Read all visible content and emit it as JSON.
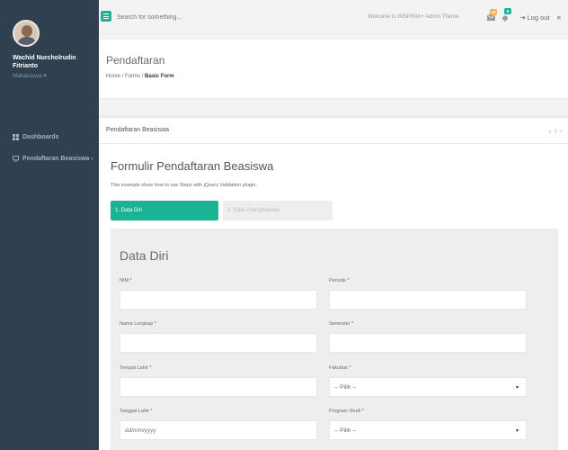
{
  "sidebar": {
    "user_name": "Wachid Nurcholrudin Fitrianto",
    "user_role": "Mahasiswa ▾",
    "items": [
      {
        "label": "Dashboards"
      },
      {
        "label": "Pendaftaran Beasiswa ‹"
      }
    ]
  },
  "topbar": {
    "search_placeholder": "Search for something...",
    "welcome": "Welcome to INSPINIA+ Admin Theme.",
    "badge_messages": "16",
    "badge_alerts": "8",
    "logout": "Log out"
  },
  "heading": {
    "title": "Pendaftaran",
    "crumb_home": "Home",
    "crumb_forms": "Forms",
    "crumb_current": "Basic Form"
  },
  "ibox": {
    "title": "Pendaftaran Beasiswa",
    "form_title": "Formulir Pendaftaran Beasiswa",
    "form_desc": "This example show how to use Steps with jQuery Validation plugin.",
    "step1": "1. Data Diri",
    "step2": "2. Data Orangtua/wali"
  },
  "form": {
    "section_title": "Data Diri",
    "nim_label": "NIM *",
    "periode_label": "Periode *",
    "nama_label": "Nama Lengkap *",
    "semester_label": "Semester *",
    "tempat_label": "Tempat Lahir *",
    "fakultas_label": "Fakultas *",
    "fakultas_value": "-- Pilih --",
    "tanggal_label": "Tanggal Lahir *",
    "tanggal_placeholder": "dd/mm/yyyy",
    "prodi_label": "Program Studi *",
    "prodi_value": "-- Pilih --"
  },
  "colors": {
    "sidebar": "#2f4050",
    "accent": "#1ab394"
  }
}
